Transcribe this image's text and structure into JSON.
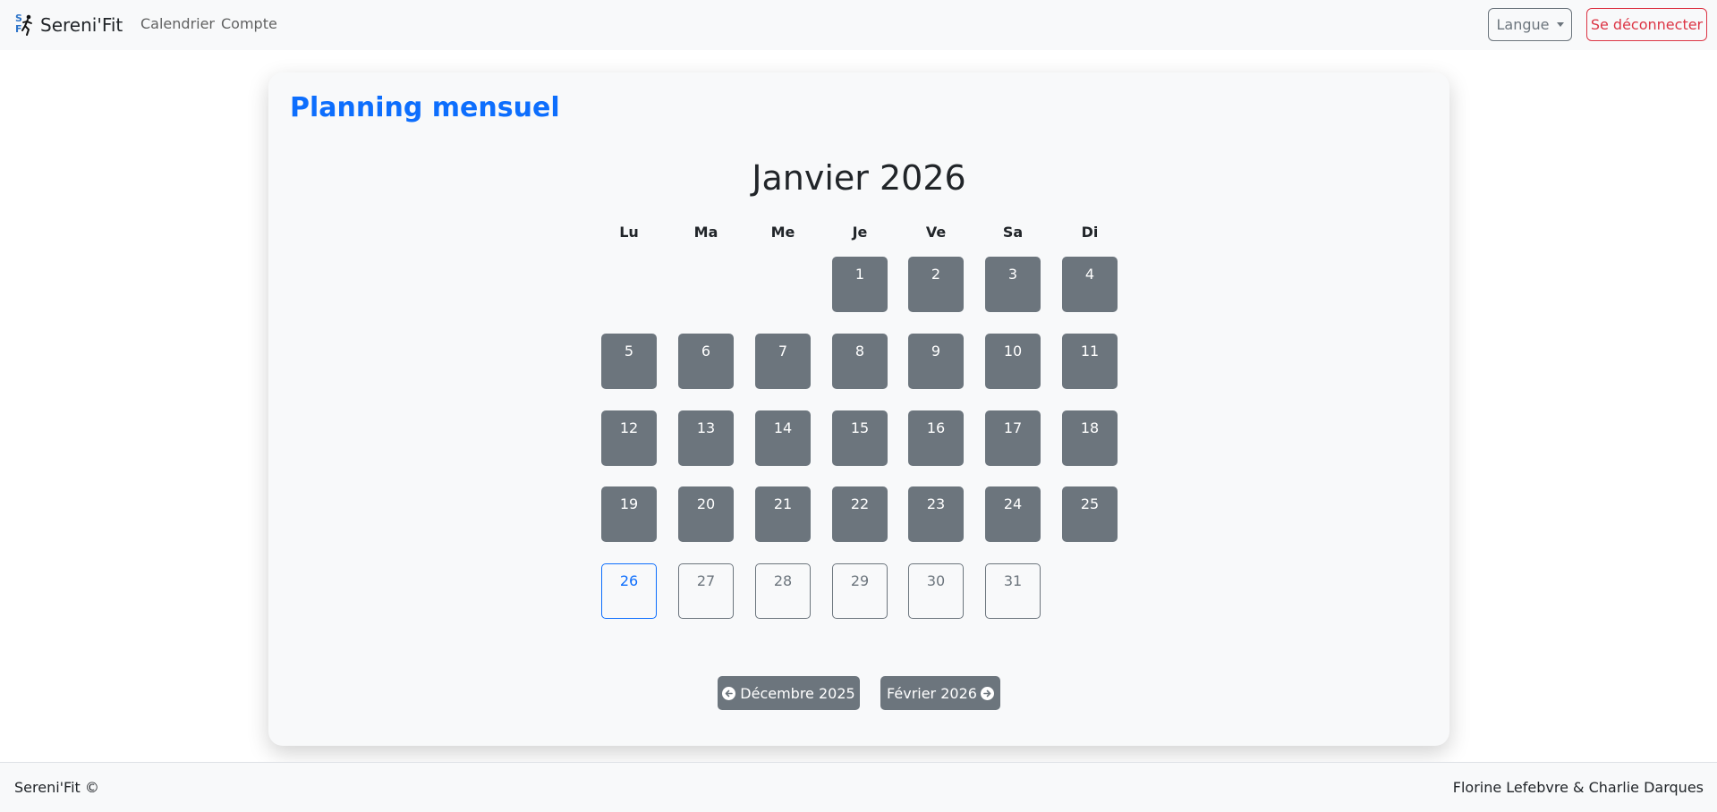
{
  "navbar": {
    "brand": "Sereni'Fit",
    "logo_letters": [
      "S",
      "F"
    ],
    "links": [
      "Calendrier",
      "Compte"
    ],
    "language_button": "Langue",
    "logout_button": "Se déconnecter"
  },
  "card": {
    "title": "Planning mensuel",
    "month_title": "Janvier 2026",
    "weekdays": [
      "Lu",
      "Ma",
      "Me",
      "Je",
      "Ve",
      "Sa",
      "Di"
    ],
    "days": [
      "1",
      "2",
      "3",
      "4",
      "5",
      "6",
      "7",
      "8",
      "9",
      "10",
      "11",
      "12",
      "13",
      "14",
      "15",
      "16",
      "17",
      "18",
      "19",
      "20",
      "21",
      "22",
      "23",
      "24",
      "25",
      "26",
      "27",
      "28",
      "29",
      "30",
      "31"
    ],
    "today": "26",
    "prev_month_button": "Décembre 2025",
    "next_month_button": "Février 2026"
  },
  "footer": {
    "left": "Sereni'Fit ©",
    "right": "Florine Lefebvre & Charlie Darques"
  },
  "colors": {
    "accent": "#0d6efd",
    "past_day": "#6c757d",
    "danger": "#dc3545",
    "background": "#f8f9fa"
  }
}
